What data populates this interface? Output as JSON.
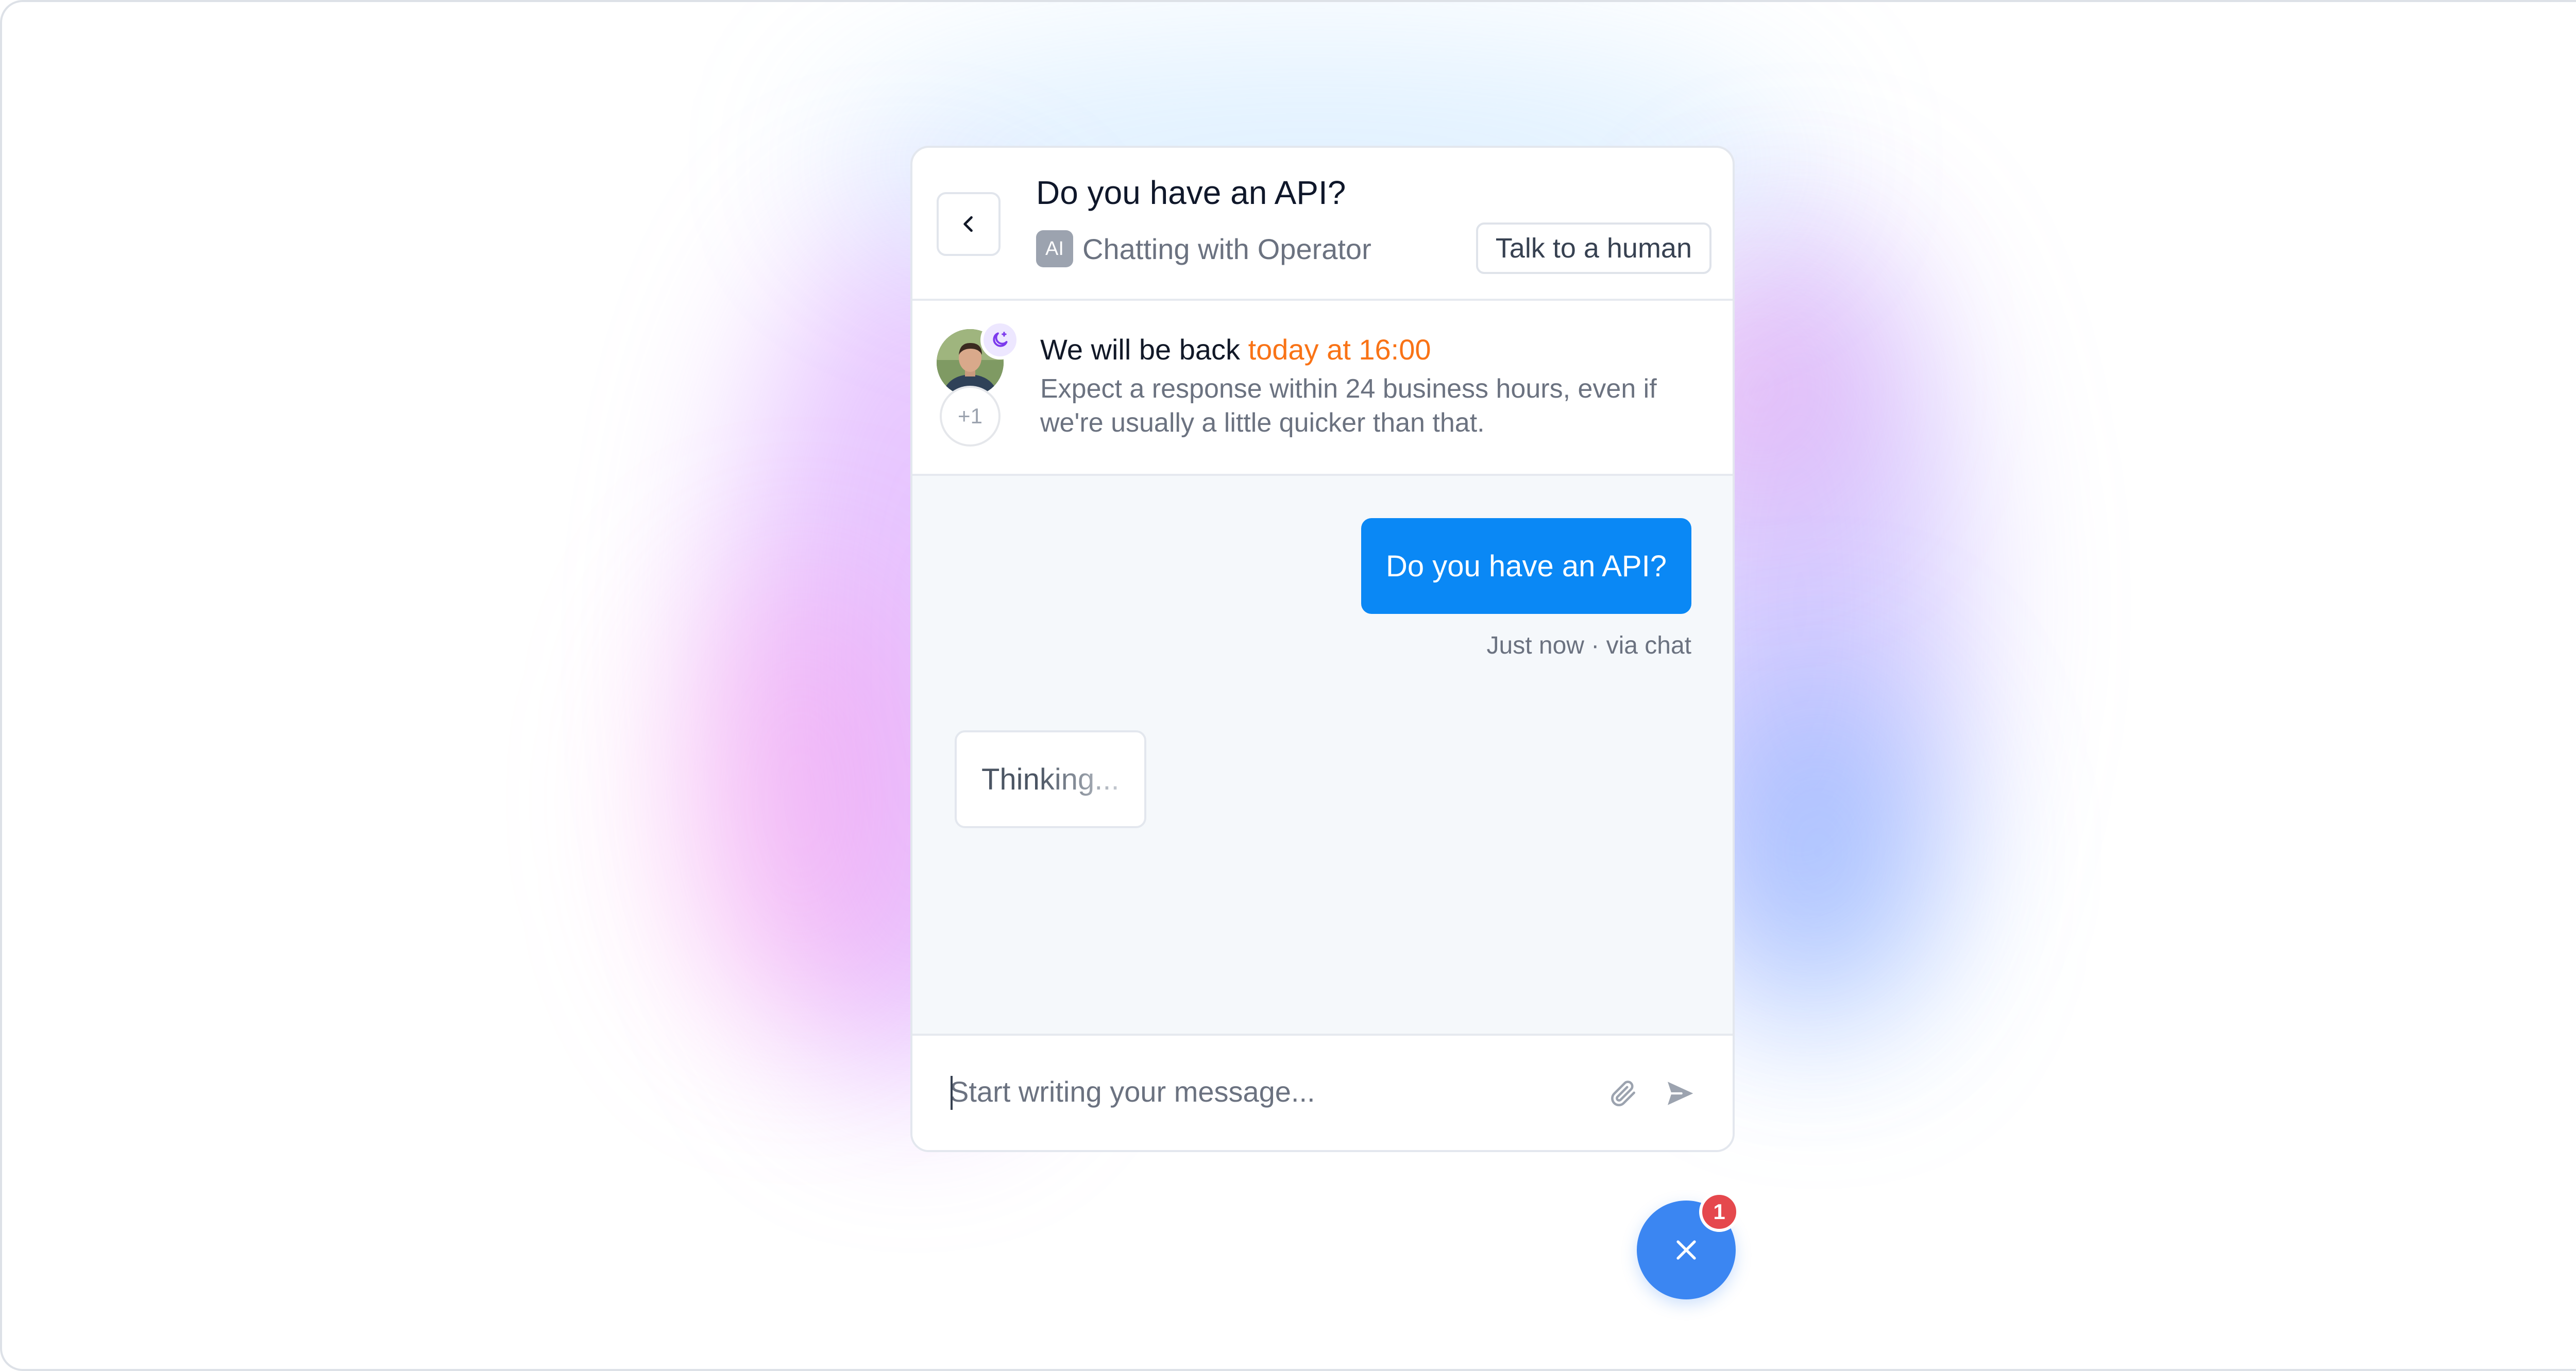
{
  "header": {
    "back_icon": "chevron-left-icon",
    "title": "Do you have an API?",
    "ai_badge": "AI",
    "chatting_with": "Chatting with",
    "operator": "Operator",
    "talk_button": "Talk to a human"
  },
  "availability": {
    "status_icon": "moon-icon",
    "extra_count": "+1",
    "headline_prefix": "We will be back",
    "headline_time": "today at 16:00",
    "description": "Expect a response within 24 business hours, even if we're usually a little quicker than that."
  },
  "conversation": {
    "user_message": "Do you have an API?",
    "message_meta": "Just now · via chat",
    "thinking": "Thinking..."
  },
  "composer": {
    "placeholder": "Start writing your message...",
    "attach_icon": "paperclip-icon",
    "send_icon": "send-icon"
  },
  "launcher": {
    "close_icon": "close-icon",
    "badge_count": "1"
  },
  "colors": {
    "accent": "#0a88f5",
    "launcher": "#3b86f2",
    "availability_time": "#f97316",
    "badge": "#e5484d"
  }
}
